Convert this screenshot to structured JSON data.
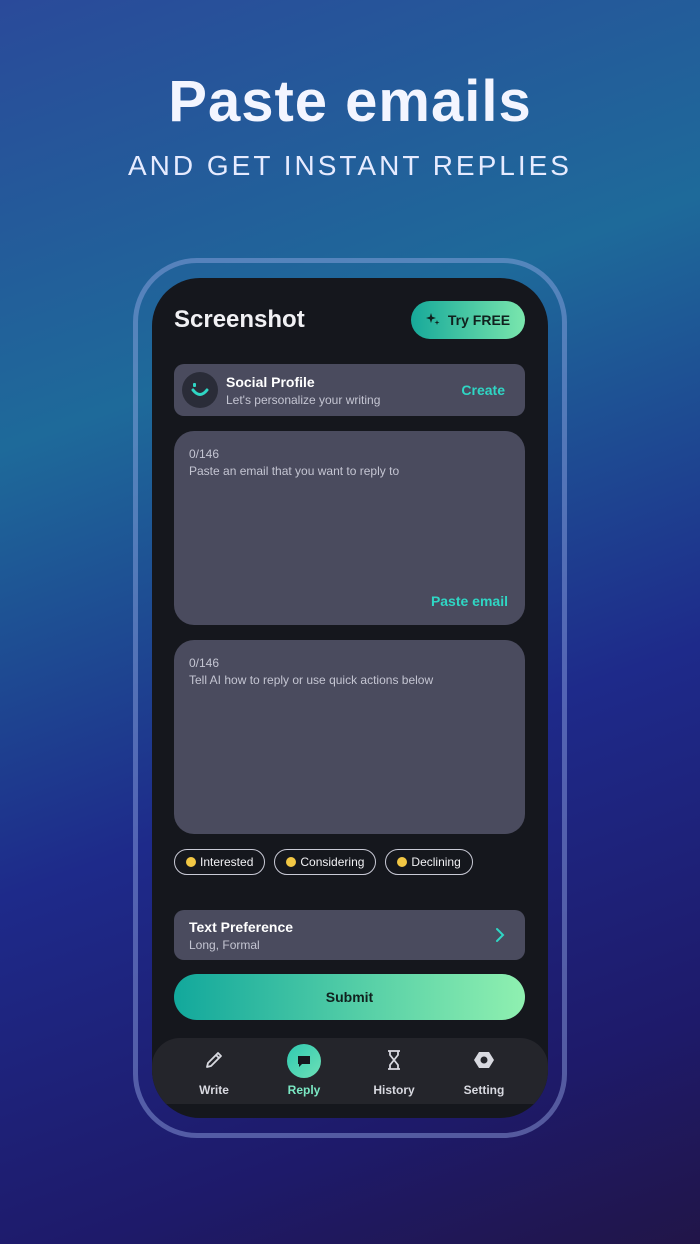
{
  "promo": {
    "headline": "Paste emails",
    "subheadline": "AND GET INSTANT REPLIES"
  },
  "header": {
    "title": "Screenshot",
    "try_button": "Try FREE"
  },
  "social_profile": {
    "title": "Social Profile",
    "subtitle": "Let's personalize your writing",
    "action": "Create"
  },
  "email_input": {
    "counter": "0/146",
    "placeholder": "Paste an email that you want to reply to",
    "action": "Paste email"
  },
  "instruction_input": {
    "counter": "0/146",
    "placeholder": "Tell AI how to reply or use quick actions below"
  },
  "quick_actions": [
    {
      "label": "Interested"
    },
    {
      "label": "Considering"
    },
    {
      "label": "Declining"
    }
  ],
  "text_preference": {
    "title": "Text Preference",
    "value": "Long, Formal"
  },
  "submit_label": "Submit",
  "tabs": [
    {
      "label": "Write",
      "icon": "pencil-icon"
    },
    {
      "label": "Reply",
      "icon": "chat-icon",
      "active": true
    },
    {
      "label": "History",
      "icon": "hourglass-icon"
    },
    {
      "label": "Setting",
      "icon": "gear-icon"
    }
  ],
  "colors": {
    "accent": "#2fd6c4",
    "card": "#4a4b5e",
    "screen": "#15171d"
  }
}
